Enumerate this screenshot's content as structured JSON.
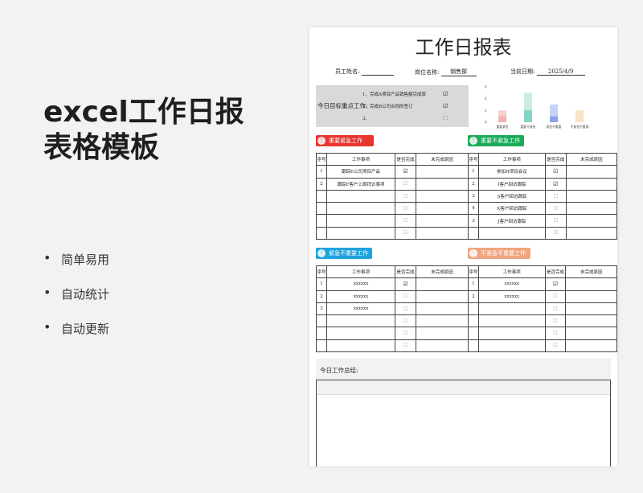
{
  "promo": {
    "title_line1": "excel工作日报",
    "title_line2": "表格模板",
    "features": [
      "简单易用",
      "自动统计",
      "自动更新"
    ]
  },
  "report": {
    "title": "工作日报表",
    "employee_label": "员工姓名:",
    "employee_value": "",
    "position_label": "岗位名称:",
    "position_value": "销售部",
    "date_label": "当前日期:",
    "date_value": "2025/4/9",
    "goals_label": "今日目标重点工作:",
    "goals": [
      {
        "text": "1、完成A项目产品销售额完成率",
        "checked": true
      },
      {
        "text": "2、完成B公司合同的签订",
        "checked": true
      },
      {
        "text": "3、",
        "checked": false
      }
    ],
    "summary_label": "今日工作总结:"
  },
  "chart_data": {
    "type": "bar",
    "categories": [
      "重要紧急",
      "重要不紧急",
      "紧急不重要",
      "不紧急不重要"
    ],
    "yticks": [
      "6",
      "4",
      "2",
      "0"
    ],
    "ylim": [
      0,
      6
    ],
    "series": [
      {
        "values": [
          2,
          5,
          3,
          2
        ]
      },
      {
        "values": [
          1,
          2,
          1,
          0
        ]
      }
    ],
    "colors_light": [
      "#f6cfcf",
      "#c8ece4",
      "#c9d3f4",
      "#f8e3c8"
    ],
    "colors_dark": [
      "#f2b1b1",
      "#82d6c4",
      "#8ea4e8",
      "#f2caa0"
    ]
  },
  "quadrants": [
    {
      "label": "重要紧急工作",
      "icon": "!",
      "color": "#e8362f",
      "headers": [
        "序号",
        "工作事项",
        "是否完成",
        "未完成原因"
      ],
      "rows": [
        {
          "no": "1",
          "task": "跟踪E公司项目产品",
          "done": true
        },
        {
          "no": "2",
          "task": "跟踪F客户上周拜访事项",
          "done": false
        },
        {
          "no": "",
          "task": "",
          "done": false
        },
        {
          "no": "",
          "task": "",
          "done": false
        },
        {
          "no": "",
          "task": "",
          "done": false
        },
        {
          "no": "",
          "task": "",
          "done": false
        }
      ]
    },
    {
      "label": "重要不紧急工作",
      "icon": "!",
      "color": "#1aab5a",
      "headers": [
        "序号",
        "工作事项",
        "是否完成",
        "未完成原因"
      ],
      "rows": [
        {
          "no": "1",
          "task": "参加H项目会议",
          "done": true
        },
        {
          "no": "2",
          "task": "I客户回访跟踪",
          "done": true
        },
        {
          "no": "3",
          "task": "S客户回访跟踪",
          "done": false
        },
        {
          "no": "4",
          "task": "X客户回访跟踪",
          "done": false
        },
        {
          "no": "3",
          "task": "J客户回访跟踪",
          "done": false
        },
        {
          "no": "",
          "task": "",
          "done": false
        }
      ]
    },
    {
      "label": "紧急不重要工作",
      "icon": "!",
      "color": "#1ea3dc",
      "headers": [
        "序号",
        "工作事项",
        "是否完成",
        "未完成原因"
      ],
      "rows": [
        {
          "no": "1",
          "task": "xxxxxx",
          "done": true
        },
        {
          "no": "2",
          "task": "xxxxxx",
          "done": false
        },
        {
          "no": "3",
          "task": "xxxxxx",
          "done": false
        },
        {
          "no": "",
          "task": "",
          "done": false
        },
        {
          "no": "",
          "task": "",
          "done": false
        },
        {
          "no": "",
          "task": "",
          "done": false
        }
      ]
    },
    {
      "label": "不紧急不重要工作",
      "icon": "!",
      "color": "#f0a67e",
      "headers": [
        "序号",
        "工作事项",
        "是否完成",
        "未完成原因"
      ],
      "rows": [
        {
          "no": "1",
          "task": "xxxxxx",
          "done": true
        },
        {
          "no": "2",
          "task": "xxxxxx",
          "done": false
        },
        {
          "no": "",
          "task": "",
          "done": false
        },
        {
          "no": "",
          "task": "",
          "done": false
        },
        {
          "no": "",
          "task": "",
          "done": false
        },
        {
          "no": "",
          "task": "",
          "done": false
        }
      ]
    }
  ]
}
